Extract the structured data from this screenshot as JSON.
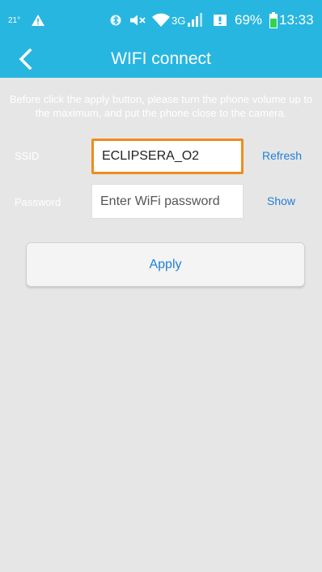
{
  "status_bar": {
    "temperature": "21°",
    "battery_percent": "69%",
    "time": "13:33",
    "network": "3G",
    "icons": [
      "alert-icon",
      "bluetooth-icon",
      "mute-icon",
      "wifi-icon",
      "signal-icon",
      "notification-icon",
      "battery-icon"
    ]
  },
  "header": {
    "title": "WIFI connect",
    "back_icon": "chevron-left-icon"
  },
  "instruction": "Before click the apply button, please turn the phone volume up to the maximum, and put the phone close to the camera.",
  "form": {
    "ssid_label": "SSID",
    "ssid_value": "ECLIPSERA_O2",
    "refresh_label": "Refresh",
    "password_label": "Password",
    "password_placeholder": "Enter WiFi password",
    "show_label": "Show"
  },
  "apply_label": "Apply",
  "colors": {
    "primary": "#27b6e0",
    "accent_link": "#1f7fd8",
    "focus_border": "#f08c1e",
    "background": "#e6e6e6"
  }
}
